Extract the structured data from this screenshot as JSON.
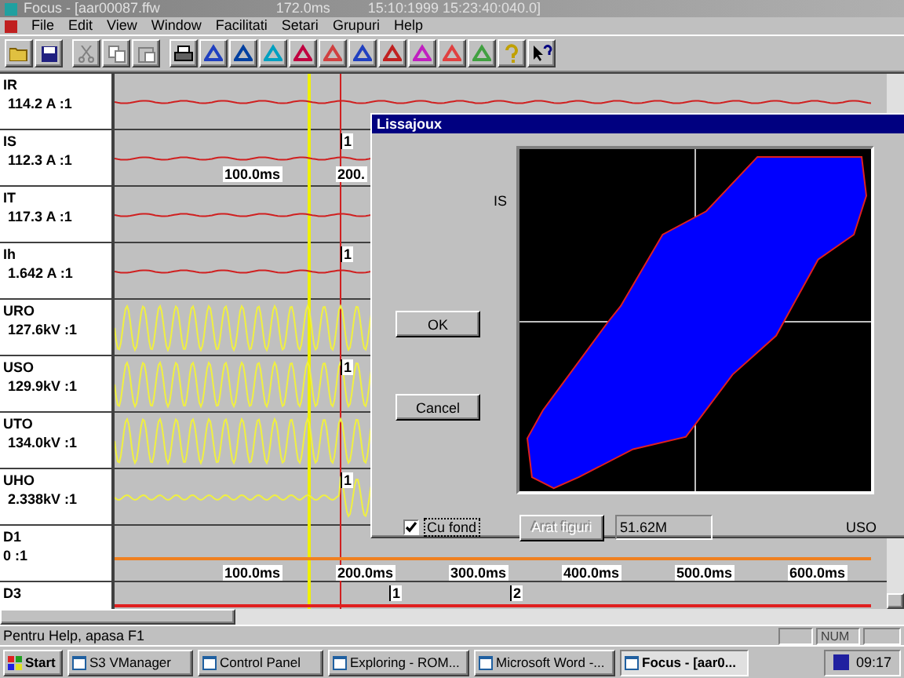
{
  "window": {
    "title": "Focus - [aar00087.ffw",
    "time_offset": "172.0ms",
    "timestamp": "15:10:1999 15:23:40:040.0]",
    "active": false
  },
  "menu": [
    "File",
    "Edit",
    "View",
    "Window",
    "Facilitati",
    "Setari",
    "Grupuri",
    "Help"
  ],
  "toolbar_groups": [
    [
      {
        "kind": "open",
        "disabled": false
      },
      {
        "kind": "save",
        "disabled": false
      }
    ],
    [
      {
        "kind": "cut",
        "disabled": true
      },
      {
        "kind": "copy",
        "disabled": true
      },
      {
        "kind": "paste",
        "disabled": true
      }
    ],
    [
      {
        "kind": "print",
        "disabled": false
      },
      {
        "kind": "tool",
        "disabled": false
      },
      {
        "kind": "tool",
        "disabled": false
      },
      {
        "kind": "tool",
        "disabled": false
      },
      {
        "kind": "tool",
        "disabled": false
      },
      {
        "kind": "tool",
        "disabled": false
      },
      {
        "kind": "tool",
        "disabled": false
      },
      {
        "kind": "tool",
        "disabled": false
      },
      {
        "kind": "tool",
        "disabled": false
      },
      {
        "kind": "tool",
        "disabled": false
      },
      {
        "kind": "tool",
        "disabled": false
      },
      {
        "kind": "help",
        "disabled": false
      },
      {
        "kind": "context-help",
        "disabled": false
      }
    ]
  ],
  "channels": [
    {
      "name": "IR",
      "value": "114.2 A :1",
      "kind": "flat",
      "color": "#d02020"
    },
    {
      "name": "IS",
      "value": "112.3 A :1",
      "kind": "flat",
      "color": "#d02020",
      "markers": [
        "1"
      ],
      "ruler": [
        "100.0ms",
        "200."
      ]
    },
    {
      "name": "IT",
      "value": "117.3 A :1",
      "kind": "flat",
      "color": "#d02020"
    },
    {
      "name": "Ih",
      "value": "1.642 A :1",
      "kind": "flat",
      "color": "#d02020",
      "markers": [
        "1"
      ]
    },
    {
      "name": "URO",
      "value": "127.6kV :1",
      "kind": "sine",
      "color": "#f0f040"
    },
    {
      "name": "USO",
      "value": "129.9kV :1",
      "kind": "sine",
      "color": "#f0f040",
      "markers": [
        "1"
      ]
    },
    {
      "name": "UTO",
      "value": "134.0kV :1",
      "kind": "sine",
      "color": "#f0f040"
    },
    {
      "name": "UHO",
      "value": "2.338kV :1",
      "kind": "small-sine",
      "color": "#f0f040",
      "markers": [
        "1"
      ]
    },
    {
      "name": "D1",
      "value": "0 :1",
      "kind": "digital",
      "color": "#f08020"
    },
    {
      "name": "D3",
      "kind": "digital",
      "color": "#e02020",
      "markers": [
        "1",
        "2"
      ]
    }
  ],
  "time_axis": [
    "100.0ms",
    "200.0ms",
    "300.0ms",
    "400.0ms",
    "500.0ms",
    "600.0ms"
  ],
  "dialog": {
    "title": "Lissajoux",
    "y_label": "IS",
    "x_label": "USO",
    "buttons": [
      {
        "label": "OK",
        "disabled": false
      },
      {
        "label": "Cancel",
        "disabled": false
      }
    ],
    "checkbox": {
      "label": "Cu fond",
      "checked": true
    },
    "figure_button": {
      "label": "Arat figuri",
      "disabled": true
    },
    "value_field": {
      "value": "51.62M"
    }
  },
  "status_bar": {
    "text": "Pentru Help, apasa F1",
    "indicator": "NUM"
  },
  "taskbar": {
    "start": "Start",
    "items": [
      {
        "label": "S3 VManager",
        "selected": false
      },
      {
        "label": "Control Panel",
        "selected": false
      },
      {
        "label": "Exploring - ROM...",
        "selected": false
      },
      {
        "label": "Microsoft Word -...",
        "selected": false
      },
      {
        "label": "Focus - [aar0...",
        "selected": true
      }
    ],
    "clock": "09:17"
  }
}
